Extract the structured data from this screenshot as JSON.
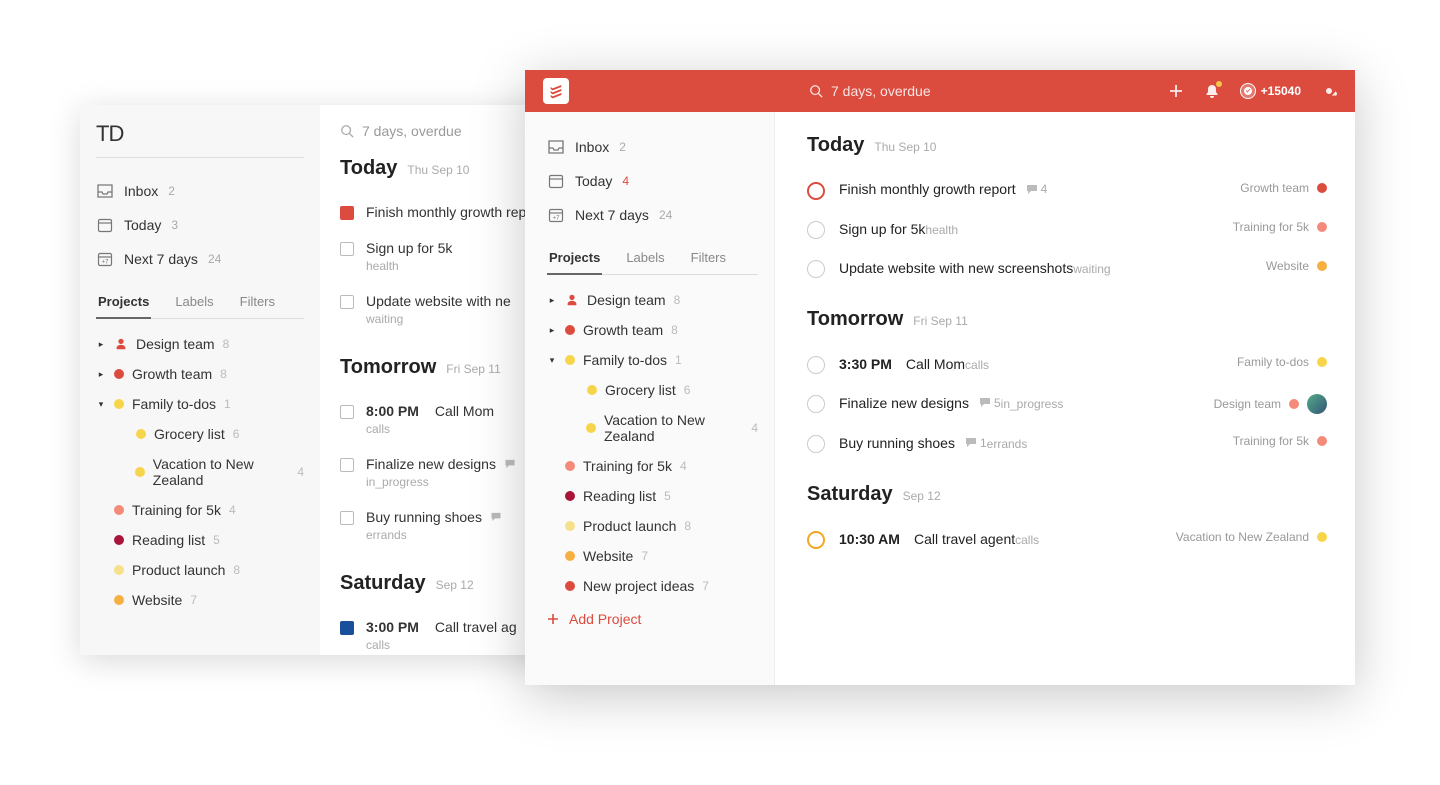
{
  "search_text": "7 days, overdue",
  "colors": {
    "accent": "#db4c3f",
    "grey_icon": "#808080"
  },
  "nav": {
    "inbox": {
      "label": "Inbox",
      "count": 2
    },
    "today_old": {
      "label": "Today",
      "count": 3
    },
    "today_new": {
      "label": "Today",
      "count": 4
    },
    "next7": {
      "label": "Next 7 days",
      "count": 24
    }
  },
  "tabs": {
    "projects": "Projects",
    "labels": "Labels",
    "filters": "Filters"
  },
  "projects": [
    {
      "name": "Design team",
      "count": 8,
      "color": "#db4c3f",
      "icon": "person",
      "expandable": true,
      "open": false
    },
    {
      "name": "Growth team",
      "count": 8,
      "color": "#db4c3f",
      "expandable": true,
      "open": false
    },
    {
      "name": "Family to-dos",
      "count": 1,
      "color": "#f7d54a",
      "expandable": true,
      "open": true,
      "children": [
        {
          "name": "Grocery list",
          "count": 6,
          "color": "#f7d54a"
        },
        {
          "name": "Vacation to New Zealand",
          "count": 4,
          "color": "#f7d54a"
        }
      ]
    },
    {
      "name": "Training for 5k",
      "count": 4,
      "color": "#f48b7a"
    },
    {
      "name": "Reading list",
      "count": 5,
      "color": "#a8143a"
    },
    {
      "name": "Product launch",
      "count": 8,
      "color": "#f7e08a"
    },
    {
      "name": "Website",
      "count": 7,
      "color": "#f5b041"
    },
    {
      "name": "New project ideas",
      "count": 7,
      "color": "#db4c3f"
    }
  ],
  "add_project": "Add Project",
  "karma_points": "+15040",
  "old_logo": "TD",
  "days": [
    {
      "heading": "Today",
      "sub": "Thu Sep 10",
      "tasks": [
        {
          "priority": "p1",
          "title": "Finish monthly growth report",
          "comments": 4,
          "project": "Growth team",
          "proj_color": "#db4c3f",
          "old_marker": "red"
        },
        {
          "priority": "",
          "title": "Sign up for 5k",
          "meta": "health",
          "project": "Training for 5k",
          "proj_color": "#f48b7a"
        },
        {
          "priority": "",
          "title": "Update website with new screenshots",
          "old_title": "Update website with ne",
          "meta": "waiting",
          "project": "Website",
          "proj_color": "#f5b041"
        }
      ]
    },
    {
      "heading": "Tomorrow",
      "sub": "Fri Sep 11",
      "tasks": [
        {
          "priority": "",
          "time_new": "3:30 PM",
          "time_old": "8:00 PM",
          "title": "Call Mom",
          "meta": "calls",
          "project": "Family to-dos",
          "proj_color": "#f7d54a"
        },
        {
          "priority": "",
          "title": "Finalize new designs",
          "meta": "in_progress",
          "comments": 5,
          "comments_icon_old": true,
          "project": "Design team",
          "proj_color": "#f48b7a",
          "avatar": true
        },
        {
          "priority": "",
          "title": "Buy running shoes",
          "meta": "errands",
          "comments": 1,
          "comments_icon_old": true,
          "project": "Training for 5k",
          "proj_color": "#f48b7a"
        }
      ]
    },
    {
      "heading": "Saturday",
      "sub": "Sep 12",
      "tasks": [
        {
          "priority": "p2",
          "time_new": "10:30 AM",
          "time_old": "3:00 PM",
          "title_new": "Call travel agent",
          "title_old": "Call travel ag",
          "meta": "calls",
          "project": "Vacation to New Zealand",
          "proj_color": "#f7d54a",
          "old_marker": "blue"
        }
      ]
    }
  ]
}
